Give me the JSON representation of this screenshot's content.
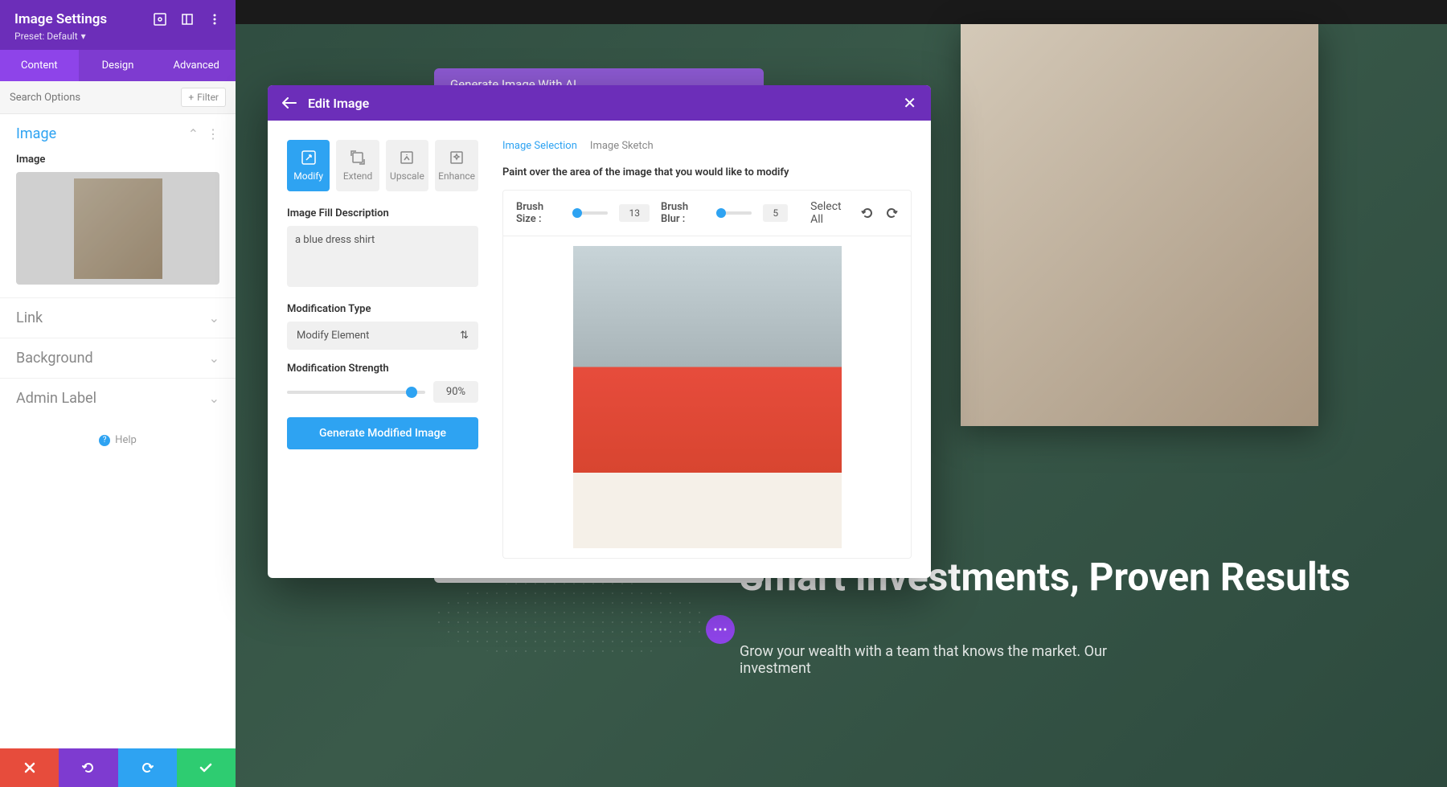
{
  "sidebar": {
    "title": "Image Settings",
    "preset": "Preset: Default",
    "tabs": {
      "content": "Content",
      "design": "Design",
      "advanced": "Advanced"
    },
    "search_placeholder": "Search Options",
    "filter_label": "Filter",
    "sections": {
      "image": {
        "title": "Image",
        "label": "Image"
      },
      "link": "Link",
      "background": "Background",
      "admin_label": "Admin Label"
    },
    "help": "Help"
  },
  "ai_peek": {
    "title": "Generate Image With AI"
  },
  "modal": {
    "title": "Edit Image",
    "actions": {
      "modify": "Modify",
      "extend": "Extend",
      "upscale": "Upscale",
      "enhance": "Enhance"
    },
    "fill_desc_label": "Image Fill Description",
    "fill_desc_value": "a blue dress shirt",
    "mod_type_label": "Modification Type",
    "mod_type_value": "Modify Element",
    "mod_strength_label": "Modification Strength",
    "mod_strength_value": "90%",
    "mod_strength_pct": 90,
    "generate_btn": "Generate Modified Image",
    "right_tabs": {
      "selection": "Image Selection",
      "sketch": "Image Sketch"
    },
    "instruction": "Paint over the area of the image that you would like to modify",
    "brush_size_label": "Brush Size :",
    "brush_size_value": "13",
    "brush_blur_label": "Brush Blur :",
    "brush_blur_value": "5",
    "select_all": "Select All"
  },
  "page": {
    "headline": "Smart Investments, Proven Results",
    "sub": "Grow your wealth with a team that knows the market. Our investment"
  },
  "colors": {
    "purple": "#6c2eb9",
    "purple_light": "#8e44e9",
    "blue": "#2ea3f2",
    "red": "#e74c3c",
    "green": "#2ecc71"
  }
}
